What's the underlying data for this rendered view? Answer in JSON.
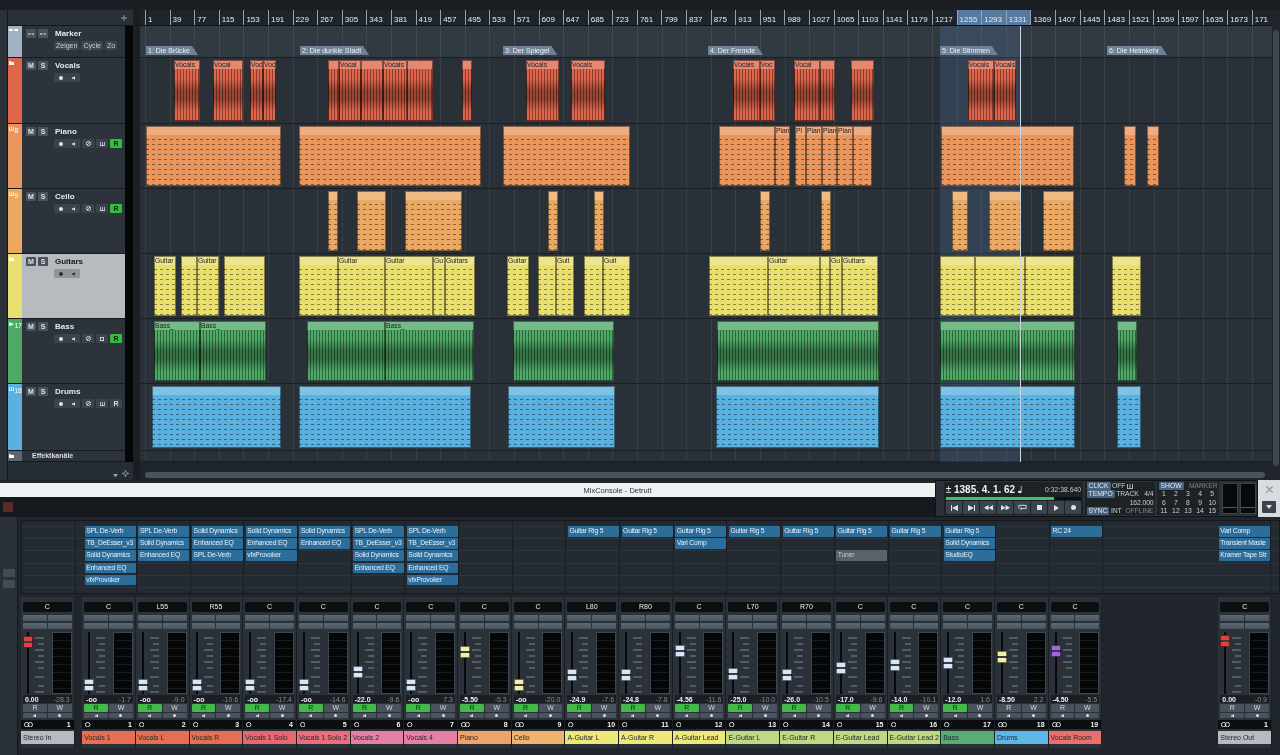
{
  "project": {
    "ruler": [
      "1",
      "39",
      "77",
      "115",
      "153",
      "191",
      "229",
      "267",
      "305",
      "343",
      "381",
      "419",
      "457",
      "495",
      "533",
      "571",
      "609",
      "647",
      "685",
      "723",
      "761",
      "799",
      "837",
      "875",
      "913",
      "951",
      "989",
      "1027",
      "1065",
      "1103",
      "1141",
      "1179",
      "1217",
      "1255",
      "1293",
      "1331",
      "1369",
      "1407",
      "1445",
      "1483",
      "1521",
      "1559",
      "1597",
      "1635",
      "1673",
      "171"
    ],
    "tracks": [
      {
        "kind": "marker",
        "name": "Marker",
        "color": "#a3b3c5",
        "selected": false,
        "options": [
          "Zeigen",
          "Cycle",
          "Zo"
        ],
        "markers": [
          {
            "label": "1: Die Brücke"
          },
          {
            "label": "2: Die dunkle Stadt"
          },
          {
            "label": "3: Der Spiegel"
          },
          {
            "label": "4: Der Fremde"
          },
          {
            "label": "5: Die Stimmen"
          },
          {
            "label": "6: Die Heimkehr"
          }
        ]
      },
      {
        "kind": "folder",
        "name": "Vocals",
        "color": "#e0664b",
        "selected": false,
        "buttons": [
          "M",
          "S"
        ],
        "clips": [
          {
            "kind": "audio",
            "label": "Vocals"
          },
          {
            "kind": "audio",
            "label": "Vocal"
          },
          {
            "kind": "audio",
            "label": "Voc"
          },
          {
            "kind": "audio",
            "label": "Voc"
          },
          {
            "kind": "audio"
          },
          {
            "kind": "audio",
            "label": "Vocal"
          },
          {
            "kind": "audio"
          },
          {
            "kind": "audio",
            "label": "Vocals"
          },
          {
            "kind": "audio"
          },
          {
            "kind": "audio"
          },
          {
            "kind": "audio",
            "label": "Vocals"
          },
          {
            "kind": "audio",
            "label": "Vocals"
          },
          {
            "kind": "audio",
            "label": "Vocals"
          },
          {
            "kind": "audio",
            "label": "Voc"
          },
          {
            "kind": "audio",
            "label": "Vocal"
          },
          {
            "kind": "audio"
          },
          {
            "kind": "audio"
          },
          {
            "kind": "audio",
            "label": "Vocals"
          },
          {
            "kind": "audio",
            "label": "Vocals"
          }
        ]
      },
      {
        "kind": "instrument",
        "number": "8",
        "name": "Piano",
        "color": "#e8955e",
        "selected": false,
        "buttons": [
          "M",
          "S"
        ],
        "read": {
          "label": "R",
          "on": true
        },
        "clips": [
          {
            "kind": "midi"
          },
          {
            "kind": "midi"
          },
          {
            "kind": "midi"
          },
          {
            "kind": "midi"
          },
          {
            "kind": "midi",
            "label": "Pian"
          },
          {
            "kind": "midi",
            "label": "Pi"
          },
          {
            "kind": "midi",
            "label": "Pian"
          },
          {
            "kind": "midi",
            "label": "Pian"
          },
          {
            "kind": "midi",
            "label": "Pian"
          },
          {
            "kind": "midi"
          },
          {
            "kind": "midi"
          },
          {
            "kind": "midi"
          },
          {
            "kind": "midi"
          }
        ]
      },
      {
        "kind": "instrument",
        "number": "9",
        "name": "Cello",
        "color": "#eaa862",
        "selected": false,
        "buttons": [
          "M",
          "S"
        ],
        "read": {
          "label": "R",
          "on": true
        },
        "clips": [
          {
            "kind": "midi"
          },
          {
            "kind": "midi"
          },
          {
            "kind": "midi"
          },
          {
            "kind": "midi"
          },
          {
            "kind": "midi"
          },
          {
            "kind": "midi"
          },
          {
            "kind": "midi"
          },
          {
            "kind": "midi"
          },
          {
            "kind": "midi"
          },
          {
            "kind": "midi"
          }
        ]
      },
      {
        "kind": "folder",
        "name": "Guitars",
        "color": "#e9df6e",
        "selected": true,
        "buttons": [
          "M",
          "S"
        ],
        "clips": [
          {
            "kind": "midi",
            "label": "Guitar"
          },
          {
            "kind": "midi"
          },
          {
            "kind": "midi",
            "label": "Guitar"
          },
          {
            "kind": "midi"
          },
          {
            "kind": "midi"
          },
          {
            "kind": "midi",
            "label": "Guitar"
          },
          {
            "kind": "midi",
            "label": "Guitar"
          },
          {
            "kind": "midi",
            "label": "Gu"
          },
          {
            "kind": "midi",
            "label": "Guitars"
          },
          {
            "kind": "midi",
            "label": "Guitar"
          },
          {
            "kind": "midi"
          },
          {
            "kind": "midi",
            "label": "Guit"
          },
          {
            "kind": "midi"
          },
          {
            "kind": "midi",
            "label": "Guit"
          },
          {
            "kind": "midi"
          },
          {
            "kind": "midi",
            "label": "Guitar"
          },
          {
            "kind": "midi"
          },
          {
            "kind": "midi",
            "label": "Gu"
          },
          {
            "kind": "midi",
            "label": "Guitars"
          },
          {
            "kind": "midi"
          },
          {
            "kind": "midi"
          },
          {
            "kind": "midi"
          },
          {
            "kind": "midi"
          }
        ]
      },
      {
        "kind": "audio",
        "number": "17",
        "name": "Bass",
        "color": "#4ea866",
        "selected": false,
        "buttons": [
          "M",
          "S"
        ],
        "read": {
          "label": "R",
          "on": true
        },
        "clips": [
          {
            "kind": "audio",
            "label": "Bass_"
          },
          {
            "kind": "audio",
            "label": "Bass_"
          },
          {
            "kind": "audio"
          },
          {
            "kind": "audio",
            "label": "Bass_"
          },
          {
            "kind": "audio"
          },
          {
            "kind": "audio"
          },
          {
            "kind": "audio"
          },
          {
            "kind": "audio"
          }
        ]
      },
      {
        "kind": "instrument",
        "number": "18",
        "name": "Drums",
        "color": "#5ab1df",
        "selected": false,
        "buttons": [
          "M",
          "S"
        ],
        "read": {
          "label": "R",
          "on": false
        },
        "clips": [
          {
            "kind": "midi"
          },
          {
            "kind": "midi"
          },
          {
            "kind": "midi"
          },
          {
            "kind": "midi"
          },
          {
            "kind": "midi"
          },
          {
            "kind": "midi"
          }
        ]
      },
      {
        "kind": "fx-folder",
        "name": "Effektkanäle",
        "color": "#5d6670",
        "selected": false
      }
    ]
  },
  "mixconsole": {
    "title": "MixConsole - Detruit",
    "transport": {
      "position": "1385. 4. 1. 62",
      "time": "0:32:38.640",
      "progress": {
        "level": 0.8
      },
      "click": {
        "label": "CLICK",
        "value": "OFF"
      },
      "tempo": {
        "label": "TEMPO",
        "mode": "TRACK",
        "signature": "4/4",
        "bpm": "162.000"
      },
      "sync": {
        "label": "SYNC",
        "source": "INT",
        "status": "OFFLINE"
      },
      "marker_panel": {
        "label": "SHOW",
        "title": "MARKER",
        "buttons": [
          "1",
          "2",
          "3",
          "4",
          "5",
          "6",
          "7",
          "8",
          "9",
          "10",
          "11",
          "12",
          "13",
          "14",
          "15"
        ]
      }
    },
    "channels": [
      {
        "kind": "input",
        "pan": "C",
        "level": 0.92,
        "volume": "0.00",
        "peak": "-28.3",
        "automation": [
          {
            "label": "R",
            "on": false
          },
          {
            "label": "W",
            "on": false
          }
        ],
        "stereo": true,
        "number": "1",
        "name": "Stereo In",
        "color": "#b7bbbf"
      },
      {
        "kind": "audio",
        "inserts": [
          {
            "kind": "plugin",
            "name": "SPL De-Verb"
          },
          {
            "kind": "plugin",
            "name": "TB_DeEsser_v3"
          },
          {
            "kind": "plugin",
            "name": "Solid Dynamics"
          },
          {
            "kind": "plugin",
            "name": "Enhanced EQ"
          },
          {
            "kind": "plugin",
            "name": "vfxProvoker"
          }
        ],
        "pan": "C",
        "level": 0.06,
        "volume": "-oo",
        "peak": "-1.7",
        "automation": [
          {
            "label": "R",
            "on": true
          },
          {
            "label": "W",
            "on": false
          }
        ],
        "stereo": false,
        "number": "1",
        "name": "Vocals 1",
        "color": "#e46f52"
      },
      {
        "kind": "audio",
        "inserts": [
          {
            "kind": "plugin",
            "name": "SPL De-Verb"
          },
          {
            "kind": "plugin",
            "name": "Solid Dynamics"
          },
          {
            "kind": "plugin",
            "name": "Enhanced EQ"
          }
        ],
        "pan": "L55",
        "level": 0.06,
        "volume": "-oo",
        "peak": "-9.0",
        "automation": [
          {
            "label": "R",
            "on": true
          },
          {
            "label": "W",
            "on": false
          }
        ],
        "stereo": false,
        "number": "2",
        "name": "Vocals L",
        "color": "#e46f52"
      },
      {
        "kind": "audio",
        "inserts": [
          {
            "kind": "plugin",
            "name": "Solid Dynamics"
          },
          {
            "kind": "plugin",
            "name": "Enhanced EQ"
          },
          {
            "kind": "plugin",
            "name": "SPL De-Verb"
          }
        ],
        "pan": "R55",
        "level": 0.06,
        "volume": "-oo",
        "peak": "-10.6",
        "automation": [
          {
            "label": "R",
            "on": true
          },
          {
            "label": "W",
            "on": false
          }
        ],
        "stereo": false,
        "number": "3",
        "name": "Vocals R",
        "color": "#e46f52"
      },
      {
        "kind": "audio",
        "inserts": [
          {
            "kind": "plugin",
            "name": "Solid Dynamics"
          },
          {
            "kind": "plugin",
            "name": "Enhanced EQ"
          },
          {
            "kind": "plugin",
            "name": "vfxProvoker"
          }
        ],
        "pan": "C",
        "level": 0.06,
        "volume": "-oo",
        "peak": "-17.4",
        "automation": [
          {
            "label": "R",
            "on": true
          },
          {
            "label": "W",
            "on": false
          }
        ],
        "stereo": false,
        "number": "4",
        "name": "Vocals 1 Solo",
        "color": "#e9676e"
      },
      {
        "kind": "audio",
        "inserts": [
          {
            "kind": "plugin",
            "name": "Solid Dynamics"
          },
          {
            "kind": "plugin",
            "name": "Enhanced EQ"
          }
        ],
        "pan": "C",
        "level": 0.06,
        "volume": "-oo",
        "peak": "-14.6",
        "automation": [
          {
            "label": "R",
            "on": true
          },
          {
            "label": "W",
            "on": false
          }
        ],
        "stereo": false,
        "number": "5",
        "name": "Vocals 1 Solo 2",
        "color": "#ea6e7e"
      },
      {
        "kind": "audio",
        "inserts": [
          {
            "kind": "plugin",
            "name": "SPL De-Verb"
          },
          {
            "kind": "plugin",
            "name": "TB_DeEsser_v3"
          },
          {
            "kind": "plugin",
            "name": "Solid Dynamics"
          },
          {
            "kind": "plugin",
            "name": "Enhanced EQ"
          }
        ],
        "pan": "C",
        "level": 0.32,
        "volume": "-22.0",
        "peak": "-9.6",
        "automation": [
          {
            "label": "R",
            "on": true
          },
          {
            "label": "W",
            "on": false
          }
        ],
        "stereo": false,
        "number": "6",
        "name": "Vocals 2",
        "color": "#e67fa5"
      },
      {
        "kind": "audio",
        "inserts": [
          {
            "kind": "plugin",
            "name": "SPL De-Verb"
          },
          {
            "kind": "plugin",
            "name": "TB_DeEsser_v3"
          },
          {
            "kind": "plugin",
            "name": "Solid Dynamics"
          },
          {
            "kind": "plugin",
            "name": "Enhanced EQ"
          },
          {
            "kind": "plugin",
            "name": "vfxProvoker"
          }
        ],
        "pan": "C",
        "level": 0.06,
        "volume": "-oo",
        "peak": "7.3",
        "automation": [
          {
            "label": "R",
            "on": true
          },
          {
            "label": "W",
            "on": false
          }
        ],
        "stereo": false,
        "number": "7",
        "name": "Vocals 4",
        "color": "#e67fa5"
      },
      {
        "kind": "instrument",
        "pan": "C",
        "level": 0.72,
        "volume": "-5.50",
        "peak": "-5.3",
        "automation": [
          {
            "label": "R",
            "on": true
          },
          {
            "label": "W",
            "on": false
          }
        ],
        "stereo": true,
        "number": "8",
        "name": "Piano",
        "color": "#eea36a"
      },
      {
        "kind": "instrument",
        "pan": "C",
        "level": 0.06,
        "volume": "-oo",
        "peak": "-20.0",
        "automation": [
          {
            "label": "R",
            "on": true
          },
          {
            "label": "W",
            "on": false
          }
        ],
        "stereo": true,
        "number": "9",
        "name": "Cello",
        "color": "#efb36e"
      },
      {
        "kind": "audio",
        "inserts": [
          {
            "kind": "plugin",
            "name": "Guitar Rig 5"
          }
        ],
        "pan": "L80",
        "level": 0.26,
        "volume": "-24.9",
        "peak": "-7.6",
        "automation": [
          {
            "label": "R",
            "on": true
          },
          {
            "label": "W",
            "on": false
          }
        ],
        "stereo": false,
        "number": "10",
        "name": "A-Guitar L",
        "color": "#eee878"
      },
      {
        "kind": "audio",
        "inserts": [
          {
            "kind": "plugin",
            "name": "Guitar Rig 5"
          }
        ],
        "pan": "R80",
        "level": 0.26,
        "volume": "-24.8",
        "peak": "-7.8",
        "automation": [
          {
            "label": "R",
            "on": true
          },
          {
            "label": "W",
            "on": false
          }
        ],
        "stereo": false,
        "number": "11",
        "name": "A-Guitar R",
        "color": "#eee878"
      },
      {
        "kind": "audio",
        "inserts": [
          {
            "kind": "plugin",
            "name": "Guitar Rig 5"
          },
          {
            "kind": "plugin",
            "name": "Vari Comp"
          }
        ],
        "pan": "C",
        "level": 0.74,
        "volume": "-4.56",
        "peak": "-11.6",
        "automation": [
          {
            "label": "R",
            "on": true
          },
          {
            "label": "W",
            "on": false
          }
        ],
        "stereo": false,
        "number": "12",
        "name": "A-Guitar Lead",
        "color": "#eee878"
      },
      {
        "kind": "audio",
        "inserts": [
          {
            "kind": "plugin",
            "name": "Guitar Rig 5"
          }
        ],
        "pan": "L70",
        "level": 0.28,
        "volume": "-25.0",
        "peak": "-10.0",
        "automation": [
          {
            "label": "R",
            "on": true
          },
          {
            "label": "W",
            "on": false
          }
        ],
        "stereo": false,
        "number": "13",
        "name": "E-Guitar L",
        "color": "#bfd884"
      },
      {
        "kind": "audio",
        "inserts": [
          {
            "kind": "plugin",
            "name": "Guitar Rig 5"
          }
        ],
        "pan": "R70",
        "level": 0.26,
        "volume": "-26.0",
        "peak": "-10.5",
        "automation": [
          {
            "label": "R",
            "on": true
          },
          {
            "label": "W",
            "on": false
          }
        ],
        "stereo": false,
        "number": "14",
        "name": "E-Guitar R",
        "color": "#bfd884"
      },
      {
        "kind": "audio",
        "inserts": [
          {
            "kind": "plugin",
            "name": "Guitar Rig 5"
          },
          {
            "kind": "empty"
          },
          {
            "kind": "bypassed",
            "name": "Tuner"
          }
        ],
        "pan": "C",
        "level": 0.4,
        "volume": "-17.0",
        "peak": "-9.6",
        "automation": [
          {
            "label": "R",
            "on": true
          },
          {
            "label": "W",
            "on": false
          }
        ],
        "stereo": false,
        "number": "15",
        "name": "E-Guitar Lead",
        "color": "#bfd884"
      },
      {
        "kind": "audio",
        "inserts": [
          {
            "kind": "plugin",
            "name": "Guitar Rig 5"
          }
        ],
        "pan": "C",
        "level": 0.46,
        "volume": "-14.0",
        "peak": "-10.1",
        "automation": [
          {
            "label": "R",
            "on": true
          },
          {
            "label": "W",
            "on": false
          }
        ],
        "stereo": false,
        "number": "16",
        "name": "E-Guitar Lead 2",
        "color": "#bfd884"
      },
      {
        "kind": "audio",
        "inserts": [
          {
            "kind": "plugin",
            "name": "Guitar Rig 5"
          },
          {
            "kind": "plugin",
            "name": "Solid Dynamics"
          },
          {
            "kind": "plugin",
            "name": "StudioEQ"
          }
        ],
        "pan": "C",
        "level": 0.5,
        "volume": "-12.0",
        "peak": "1.6",
        "automation": [
          {
            "label": "R",
            "on": true
          },
          {
            "label": "W",
            "on": false
          }
        ],
        "stereo": false,
        "number": "17",
        "name": "Bass",
        "color": "#57ad72"
      },
      {
        "kind": "instrument",
        "pan": "C",
        "level": 0.62,
        "volume": "-8.50",
        "peak": "2.2",
        "automation": [
          {
            "label": "R",
            "on": false
          },
          {
            "label": "W",
            "on": false
          }
        ],
        "stereo": true,
        "number": "18",
        "name": "Drums",
        "color": "#5db6e6"
      },
      {
        "kind": "fx",
        "inserts": [
          {
            "kind": "plugin",
            "name": "RC 24"
          }
        ],
        "pan": "C",
        "level": 0.74,
        "volume": "-4.50",
        "peak": "-5.5",
        "automation": [
          {
            "label": "R",
            "on": false
          },
          {
            "label": "W",
            "on": false
          }
        ],
        "stereo": true,
        "number": "19",
        "name": "Vocals Room",
        "color": "#ec6f6f"
      },
      {
        "kind": "output",
        "inserts": [
          {
            "kind": "plugin",
            "name": "Vari Comp"
          },
          {
            "kind": "plugin",
            "name": "Transient Maste"
          },
          {
            "kind": "plugin",
            "name": "Kramer Tape Str"
          }
        ],
        "pan": "C",
        "level": 0.94,
        "volume": "0.00",
        "peak": "-0.9",
        "automation": [
          {
            "label": "R",
            "on": false
          },
          {
            "label": "W",
            "on": false
          }
        ],
        "stereo": true,
        "number": "1",
        "name": "Stereo Out",
        "color": "#b7bbbf"
      }
    ]
  }
}
